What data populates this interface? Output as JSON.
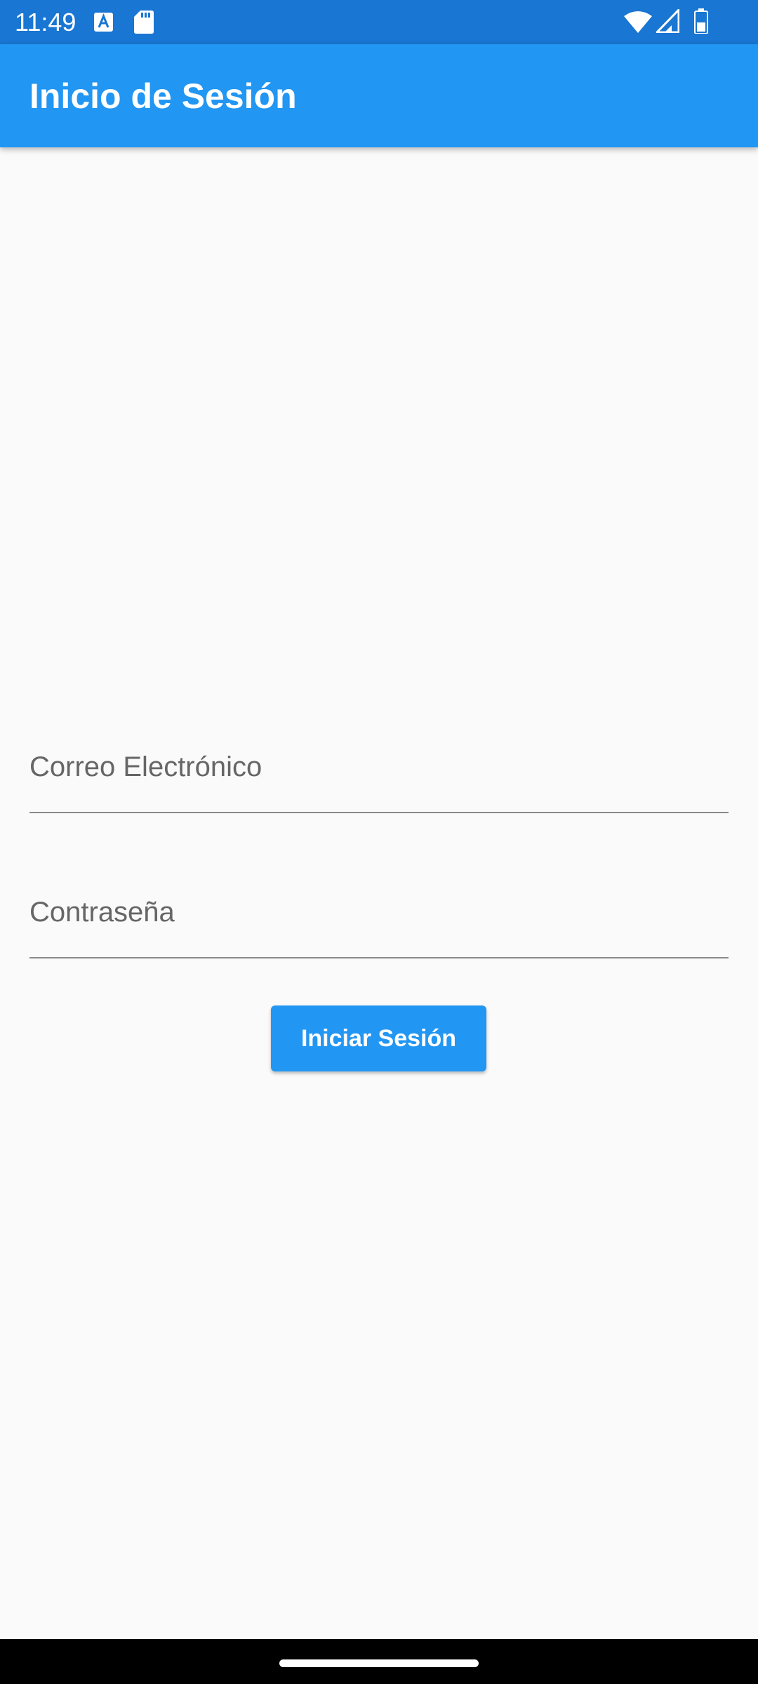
{
  "status_bar": {
    "time": "11:49",
    "icons": [
      "text-a-icon",
      "sd-card-icon",
      "wifi-icon",
      "cell-signal-icon",
      "battery-icon"
    ]
  },
  "app_bar": {
    "title": "Inicio de Sesión",
    "color": "#2196f3"
  },
  "form": {
    "email": {
      "label": "Correo Electrónico",
      "value": ""
    },
    "password": {
      "label": "Contraseña",
      "value": ""
    },
    "submit_label": "Iniciar Sesión"
  },
  "colors": {
    "status_bar": "#1976d2",
    "primary": "#2196f3",
    "background": "#fafafa"
  }
}
